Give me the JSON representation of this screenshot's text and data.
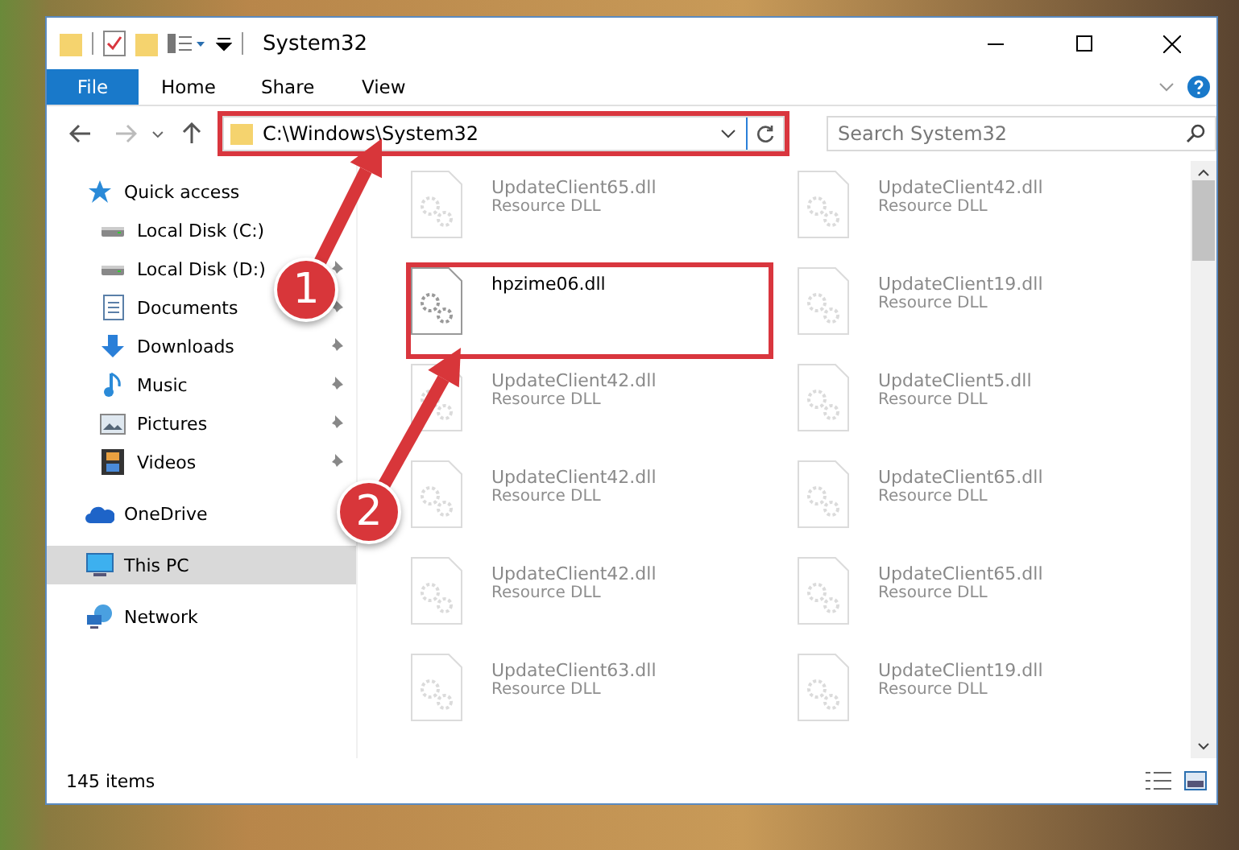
{
  "window": {
    "title": "System32"
  },
  "ribbon": {
    "tabs": [
      {
        "label": "File",
        "selected": true
      },
      {
        "label": "Home",
        "selected": false
      },
      {
        "label": "Share",
        "selected": false
      },
      {
        "label": "View",
        "selected": false
      }
    ]
  },
  "address_bar": {
    "path": "C:\\Windows\\System32",
    "highlighted": true
  },
  "search": {
    "placeholder": "Search System32"
  },
  "sidebar": {
    "items": [
      {
        "label": "Quick access",
        "kind": "quick",
        "selected": false,
        "children": [
          {
            "label": "Local Disk (C:)",
            "kind": "disk",
            "pinned": false
          },
          {
            "label": "Local Disk (D:)",
            "kind": "disk",
            "pinned": true
          },
          {
            "label": "Documents",
            "kind": "documents",
            "pinned": true
          },
          {
            "label": "Downloads",
            "kind": "downloads",
            "pinned": true
          },
          {
            "label": "Music",
            "kind": "music",
            "pinned": true
          },
          {
            "label": "Pictures",
            "kind": "pictures",
            "pinned": true
          },
          {
            "label": "Videos",
            "kind": "videos",
            "pinned": true
          }
        ]
      },
      {
        "label": "OneDrive",
        "kind": "cloud",
        "selected": false
      },
      {
        "label": "This PC",
        "kind": "pc",
        "selected": true
      },
      {
        "label": "Network",
        "kind": "network",
        "selected": false
      }
    ]
  },
  "files": [
    {
      "name": "UpdateClient65.dll",
      "type": "Resource DLL",
      "faded": true,
      "highlighted": false
    },
    {
      "name": "UpdateClient42.dll",
      "type": "Resource DLL",
      "faded": true,
      "highlighted": false
    },
    {
      "name": "hpzime06.dll",
      "faded": false,
      "highlighted": true
    },
    {
      "name": "UpdateClient19.dll",
      "type": "Resource DLL",
      "faded": true,
      "highlighted": false
    },
    {
      "name": "UpdateClient42.dll",
      "type": "Resource DLL",
      "faded": true,
      "highlighted": false
    },
    {
      "name": "UpdateClient5.dll",
      "type": "Resource DLL",
      "faded": true,
      "highlighted": false
    },
    {
      "name": "UpdateClient42.dll",
      "type": "Resource DLL",
      "faded": true,
      "highlighted": false
    },
    {
      "name": "UpdateClient65.dll",
      "type": "Resource DLL",
      "faded": true,
      "highlighted": false
    },
    {
      "name": "UpdateClient42.dll",
      "type": "Resource DLL",
      "faded": true,
      "highlighted": false
    },
    {
      "name": "UpdateClient65.dll",
      "type": "Resource DLL",
      "faded": true,
      "highlighted": false
    },
    {
      "name": "UpdateClient63.dll",
      "type": "Resource DLL",
      "faded": true,
      "highlighted": false
    },
    {
      "name": "UpdateClient19.dll",
      "type": "Resource DLL",
      "faded": true,
      "highlighted": false
    }
  ],
  "status_bar": {
    "item_count": "145 items"
  },
  "callouts": [
    {
      "label": "1"
    },
    {
      "label": "2"
    }
  ]
}
